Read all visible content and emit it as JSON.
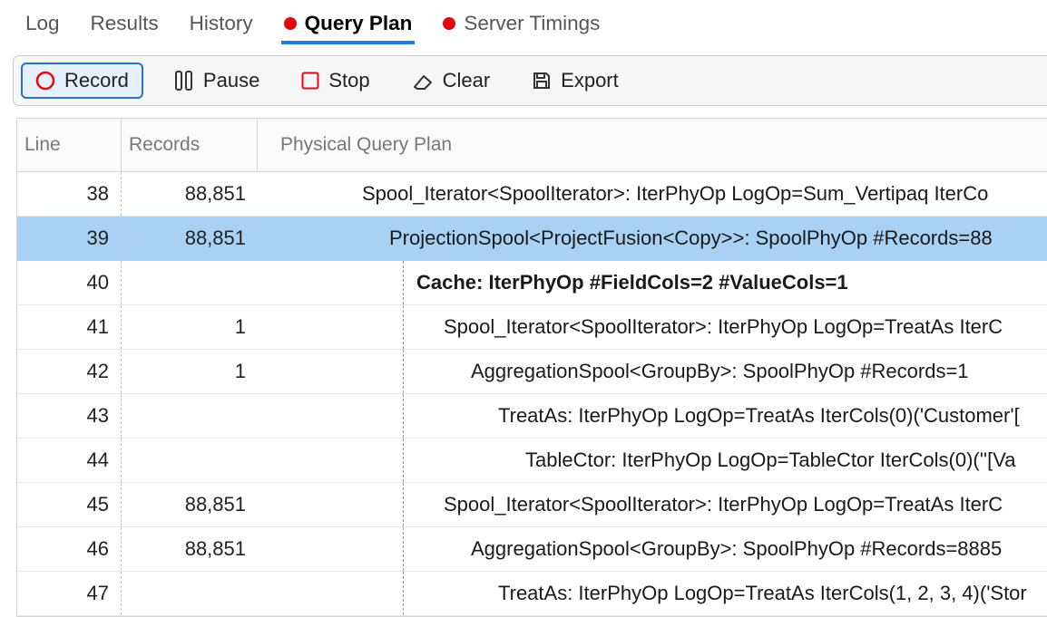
{
  "tabs": {
    "items": [
      {
        "label": "Log",
        "hasDot": false,
        "active": false
      },
      {
        "label": "Results",
        "hasDot": false,
        "active": false
      },
      {
        "label": "History",
        "hasDot": false,
        "active": false
      },
      {
        "label": "Query Plan",
        "hasDot": true,
        "active": true
      },
      {
        "label": "Server Timings",
        "hasDot": true,
        "active": false
      }
    ]
  },
  "toolbar": {
    "record": "Record",
    "pause": "Pause",
    "stop": "Stop",
    "clear": "Clear",
    "export": "Export"
  },
  "columns": {
    "line": "Line",
    "records": "Records",
    "plan": "Physical Query Plan"
  },
  "rows": [
    {
      "line": "38",
      "records": "88,851",
      "indent": 115,
      "bold": false,
      "selected": false,
      "text": "Spool_Iterator<SpoolIterator>: IterPhyOp LogOp=Sum_Vertipaq IterCo"
    },
    {
      "line": "39",
      "records": "88,851",
      "indent": 145,
      "bold": false,
      "selected": true,
      "text": "ProjectionSpool<ProjectFusion<Copy>>: SpoolPhyOp #Records=88"
    },
    {
      "line": "40",
      "records": "",
      "indent": 175,
      "bold": true,
      "selected": false,
      "text": "Cache: IterPhyOp #FieldCols=2 #ValueCols=1"
    },
    {
      "line": "41",
      "records": "1",
      "indent": 205,
      "bold": false,
      "selected": false,
      "text": "Spool_Iterator<SpoolIterator>: IterPhyOp LogOp=TreatAs IterC"
    },
    {
      "line": "42",
      "records": "1",
      "indent": 235,
      "bold": false,
      "selected": false,
      "text": "AggregationSpool<GroupBy>: SpoolPhyOp #Records=1"
    },
    {
      "line": "43",
      "records": "",
      "indent": 265,
      "bold": false,
      "selected": false,
      "text": "TreatAs: IterPhyOp LogOp=TreatAs IterCols(0)('Customer'["
    },
    {
      "line": "44",
      "records": "",
      "indent": 295,
      "bold": false,
      "selected": false,
      "text": "TableCtor: IterPhyOp LogOp=TableCtor IterCols(0)(''[Va"
    },
    {
      "line": "45",
      "records": "88,851",
      "indent": 205,
      "bold": false,
      "selected": false,
      "text": "Spool_Iterator<SpoolIterator>: IterPhyOp LogOp=TreatAs IterC"
    },
    {
      "line": "46",
      "records": "88,851",
      "indent": 235,
      "bold": false,
      "selected": false,
      "text": "AggregationSpool<GroupBy>: SpoolPhyOp #Records=8885"
    },
    {
      "line": "47",
      "records": "",
      "indent": 265,
      "bold": false,
      "selected": false,
      "text": "TreatAs: IterPhyOp LogOp=TreatAs IterCols(1, 2, 3, 4)('Stor"
    }
  ],
  "ui_state": {
    "selectedTabIndex": 3,
    "selectedRowLine": "39"
  }
}
